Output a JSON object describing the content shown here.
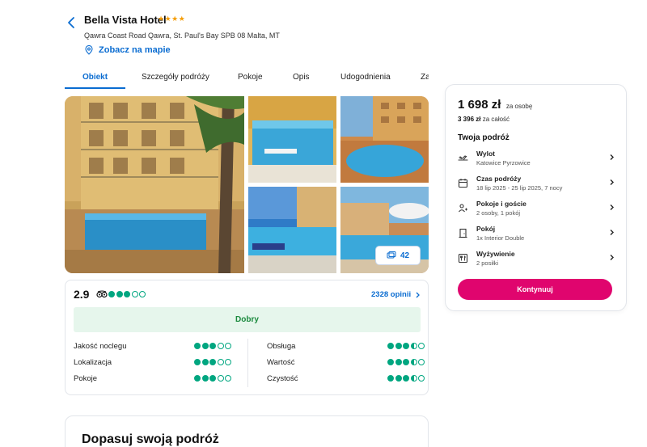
{
  "hotel": {
    "name": "Bella Vista Hotel",
    "stars": "★★★★",
    "address": "Qawra Coast Road Qawra, St. Paul's Bay SPB 08 Malta, MT",
    "map_link": "Zobacz na mapie"
  },
  "tabs": [
    {
      "label": "Obiekt",
      "active": true
    },
    {
      "label": "Szczegóły podróży"
    },
    {
      "label": "Pokoje"
    },
    {
      "label": "Opis"
    },
    {
      "label": "Udogodnienia"
    },
    {
      "label": "Za"
    }
  ],
  "gallery": {
    "photo_count": "42"
  },
  "reviews": {
    "score": "2.9",
    "rating_bubbles": 3,
    "count_link": "2328 opinii",
    "verdict": "Dobry",
    "categories": [
      {
        "label": "Jakość noclegu",
        "rating": 3
      },
      {
        "label": "Obsługa",
        "rating": 3.5
      },
      {
        "label": "Lokalizacja",
        "rating": 3
      },
      {
        "label": "Wartość",
        "rating": 3.5
      },
      {
        "label": "Pokoje",
        "rating": 3
      },
      {
        "label": "Czystość",
        "rating": 3.5
      }
    ]
  },
  "customize": {
    "title": "Dopasuj swoją podróż"
  },
  "booking": {
    "price": "1 698 zł",
    "price_unit": "za osobę",
    "total_price": "3 396 zł",
    "total_unit": "za całość",
    "heading": "Twoja podróż",
    "rows": [
      {
        "icon": "plane-icon",
        "title": "Wylot",
        "subtitle": "Katowice Pyrzowice"
      },
      {
        "icon": "calendar-icon",
        "title": "Czas podróży",
        "subtitle": "18 lip 2025 - 25 lip 2025, 7 nocy"
      },
      {
        "icon": "guests-icon",
        "title": "Pokoje i goście",
        "subtitle": "2 osoby, 1 pokój"
      },
      {
        "icon": "door-icon",
        "title": "Pokój",
        "subtitle": "1x Interior Double"
      },
      {
        "icon": "meal-icon",
        "title": "Wyżywienie",
        "subtitle": "2 posiłki"
      }
    ],
    "cta": "Kontynuuj"
  },
  "colors": {
    "accent": "#0a6cd1",
    "cta": "#e0056e",
    "rating": "#00a680",
    "verdict_bg": "#e6f6ec",
    "verdict_text": "#1b8a3e"
  }
}
